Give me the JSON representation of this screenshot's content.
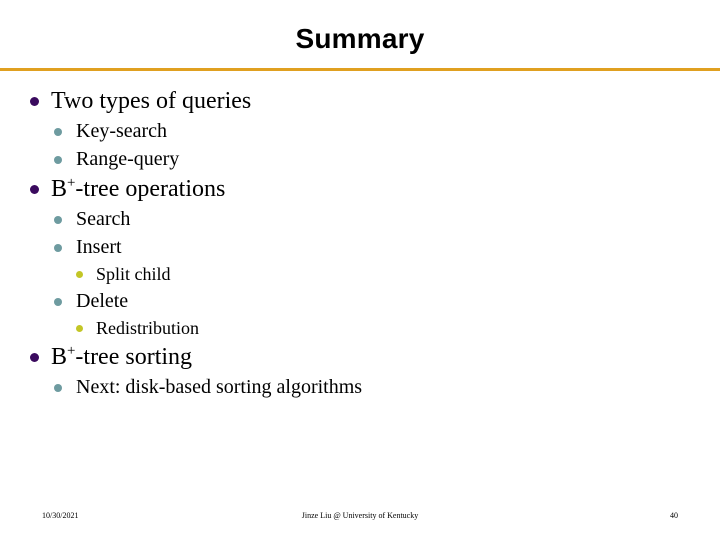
{
  "slide": {
    "title": "Summary",
    "rule_color": "#e0a020",
    "background": "#ffffff"
  },
  "bullet_colors": {
    "level1": "#3a0a5e",
    "level2": "#6e9ba0",
    "level3": "#c3c626"
  },
  "outline": [
    {
      "level": 1,
      "text": "Two types of queries"
    },
    {
      "level": 2,
      "text": "Key-search"
    },
    {
      "level": 2,
      "text": "Range-query"
    },
    {
      "level": 1,
      "text_before": "B",
      "superscript": "+",
      "text_after": "-tree operations"
    },
    {
      "level": 2,
      "text": "Search"
    },
    {
      "level": 2,
      "text": "Insert"
    },
    {
      "level": 3,
      "text": "Split child"
    },
    {
      "level": 2,
      "text": "Delete"
    },
    {
      "level": 3,
      "text": "Redistribution"
    },
    {
      "level": 1,
      "text_before": "B",
      "superscript": "+",
      "text_after": "-tree sorting"
    },
    {
      "level": 2,
      "text": "Next: disk-based sorting algorithms"
    }
  ],
  "footer": {
    "date": "10/30/2021",
    "center": "Jinze Liu @ University of Kentucky",
    "page_number": "40"
  }
}
